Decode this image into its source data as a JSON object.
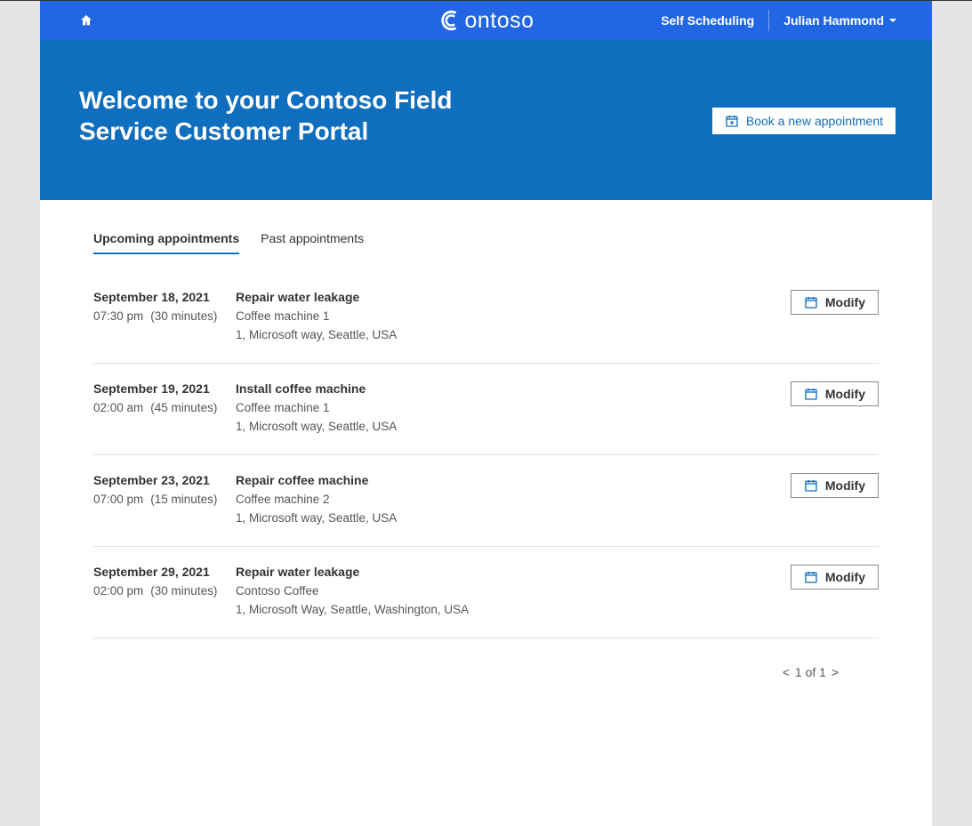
{
  "brand": {
    "name": "ontoso"
  },
  "nav": {
    "self_scheduling": "Self Scheduling",
    "user_name": "Julian Hammond"
  },
  "hero": {
    "title": "Welcome to your Contoso Field Service Customer Portal",
    "book_button": "Book a new appointment"
  },
  "tabs": {
    "upcoming": "Upcoming appointments",
    "past": "Past appointments"
  },
  "modify_label": "Modify",
  "appointments": [
    {
      "date": "September 18, 2021",
      "time": "07:30 pm",
      "duration": "(30 minutes)",
      "title": "Repair water leakage",
      "item": "Coffee machine 1",
      "address": "1, Microsoft way, Seattle, USA"
    },
    {
      "date": "September 19, 2021",
      "time": "02:00 am",
      "duration": "(45 minutes)",
      "title": "Install coffee machine",
      "item": "Coffee machine 1",
      "address": "1, Microsoft way, Seattle, USA"
    },
    {
      "date": "September 23, 2021",
      "time": "07:00 pm",
      "duration": "(15 minutes)",
      "title": "Repair coffee machine",
      "item": "Coffee machine 2",
      "address": "1, Microsoft way, Seattle, USA"
    },
    {
      "date": "September 29, 2021",
      "time": "02:00 pm",
      "duration": "(30 minutes)",
      "title": "Repair water leakage",
      "item": "Contoso Coffee",
      "address": "1, Microsoft Way, Seattle, Washington, USA"
    }
  ],
  "pagination": {
    "prev": "<",
    "text": "1 of 1",
    "next": ">"
  }
}
